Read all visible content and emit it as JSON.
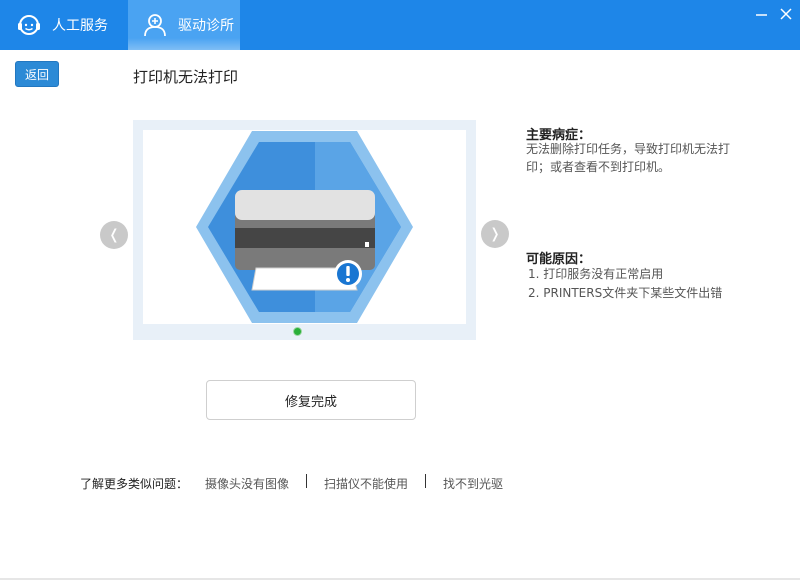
{
  "tabs": [
    {
      "label": "人工服务",
      "icon": "headset-icon"
    },
    {
      "label": "驱动诊所",
      "icon": "doctor-icon",
      "active": true
    }
  ],
  "window_controls": {
    "minimize": "minimize-icon",
    "close": "close-icon"
  },
  "back_button": "返回",
  "page_title": "打印机无法打印",
  "carousel": {
    "image": "printer-error-illustration",
    "prev_icon": "chevron-left-icon",
    "next_icon": "chevron-right-icon",
    "prev_glyph": "❬",
    "next_glyph": "❭",
    "active_dot_color": "#2bb03a"
  },
  "symptom": {
    "title": "主要病症：",
    "text": "无法删除打印任务，导致打印机无法打印；或者查看不到打印机。"
  },
  "causes": {
    "title": "可能原因：",
    "items": [
      "1. 打印服务没有正常启用",
      "2. PRINTERS文件夹下某些文件出错"
    ]
  },
  "fix_button": "修复完成",
  "related": {
    "label": "了解更多类似问题：",
    "links": [
      "摄像头没有图像",
      "扫描仪不能使用",
      "找不到光驱"
    ]
  },
  "colors": {
    "titlebar": "#1e86e8",
    "active_tab": "#4aa3f2",
    "back_button": "#2c8ad6"
  }
}
